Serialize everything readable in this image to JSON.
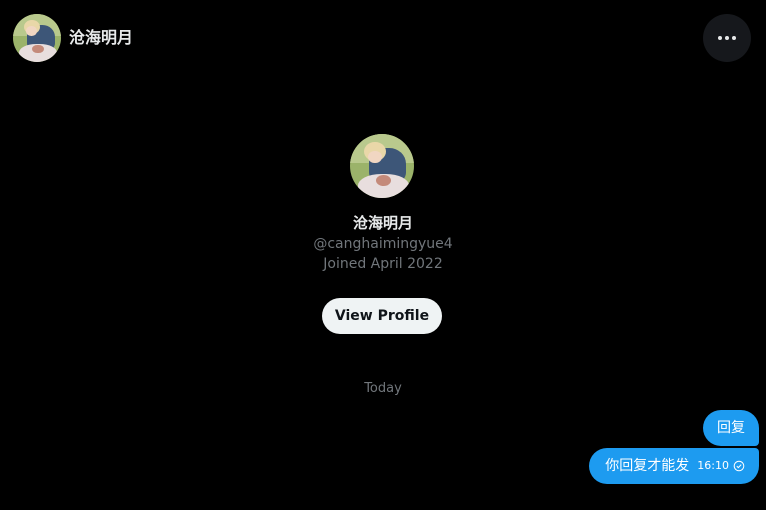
{
  "header": {
    "name": "沧海明月"
  },
  "profile": {
    "name": "沧海明月",
    "handle": "@canghaimingyue4",
    "joined": "Joined April 2022",
    "view_profile_label": "View Profile"
  },
  "conversation": {
    "date_separator": "Today",
    "messages": [
      {
        "text": "回复"
      },
      {
        "text": "你回复才能发",
        "time": "16:10"
      }
    ]
  },
  "icons": {
    "more": "more-horizontal-icon",
    "read_receipt": "check-circle-icon"
  },
  "colors": {
    "background": "#000000",
    "accent": "#1d9bf0",
    "text_primary": "#e7e9ea",
    "text_secondary": "#71767b",
    "button_bg": "#eff3f4"
  }
}
